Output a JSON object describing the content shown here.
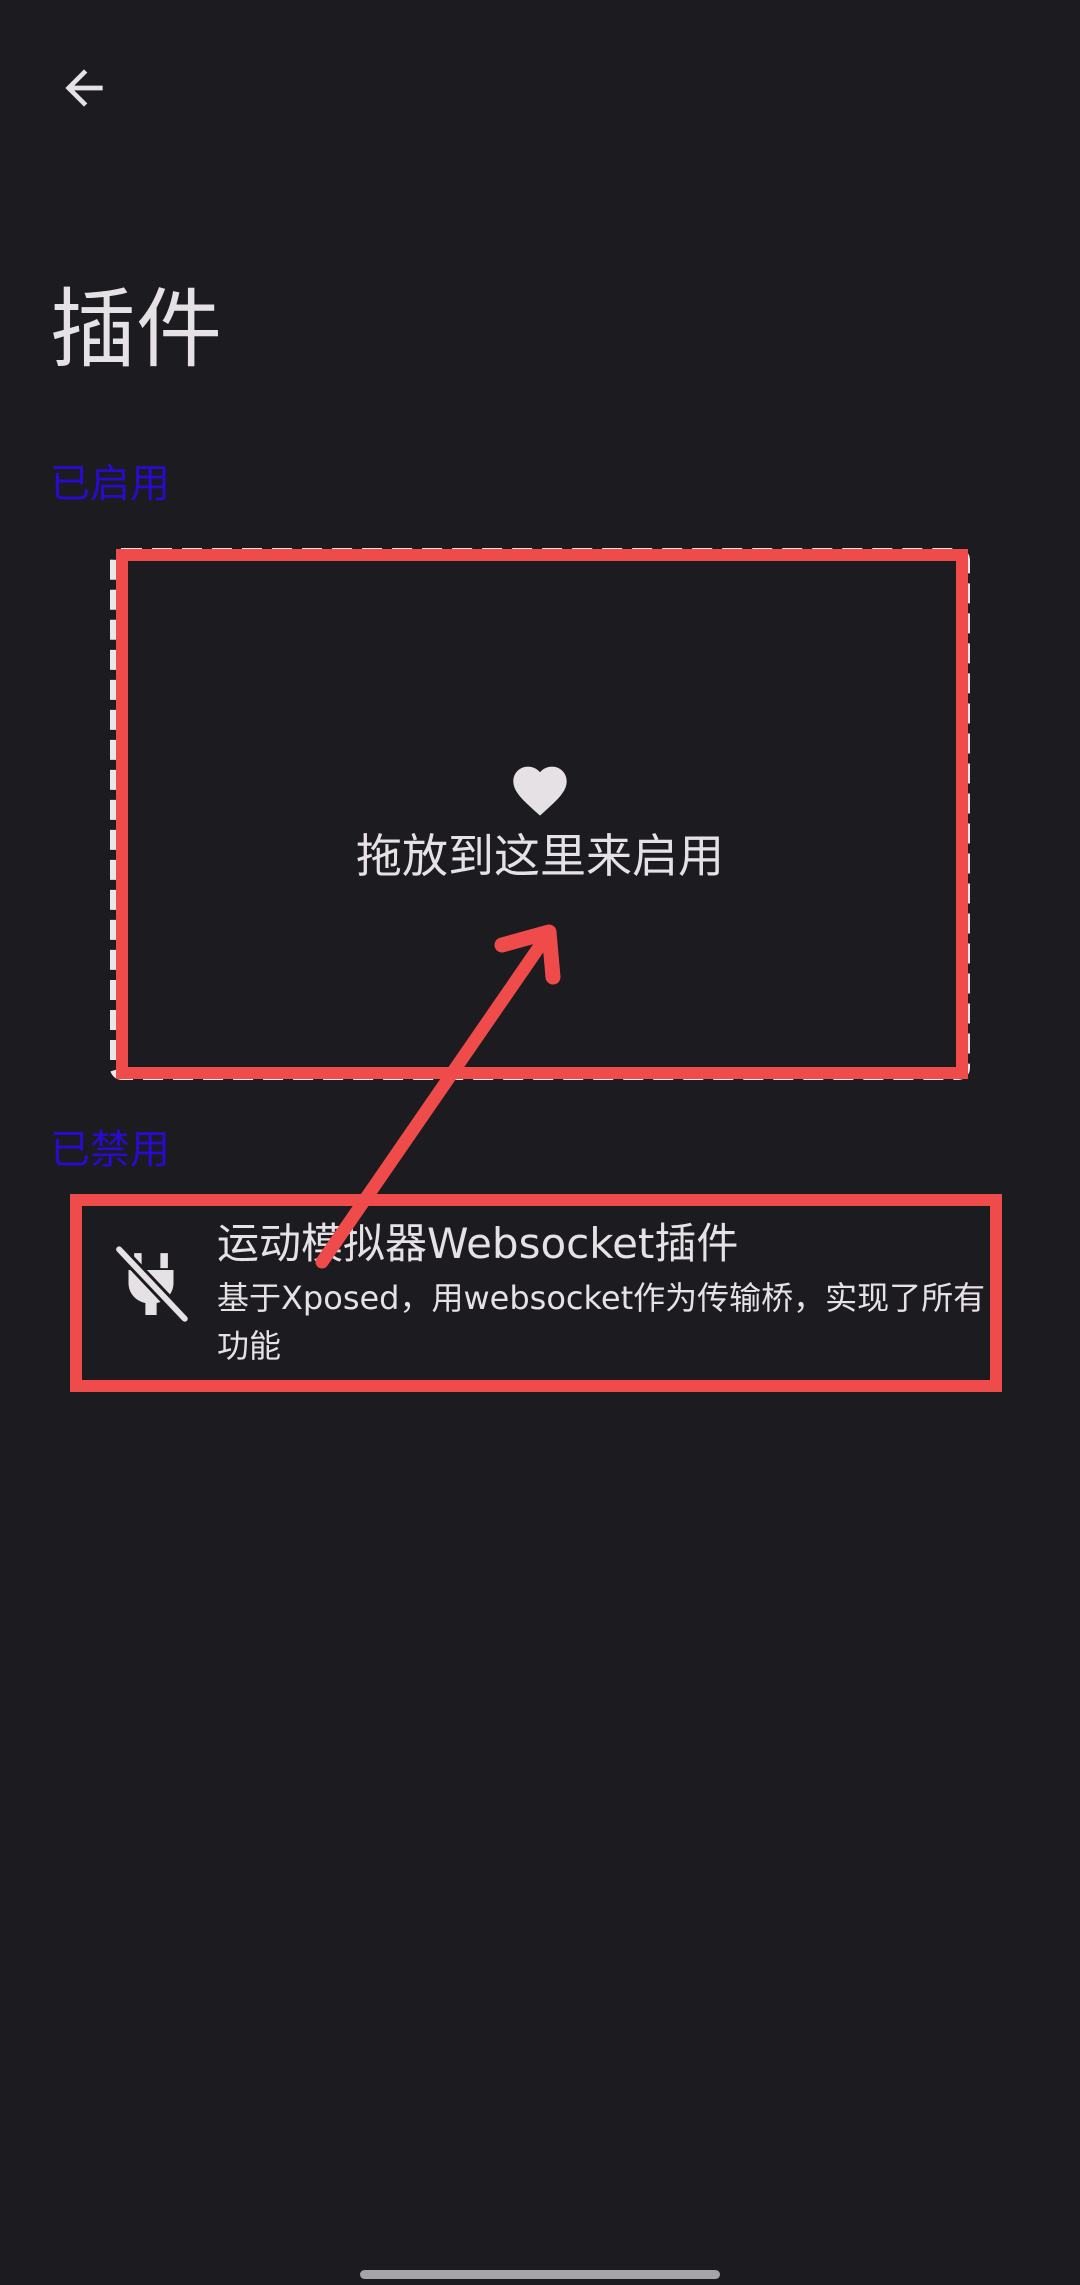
{
  "header": {
    "back_icon": "arrow-back-icon"
  },
  "page": {
    "title": "插件"
  },
  "sections": {
    "enabled_label": "已启用",
    "disabled_label": "已禁用"
  },
  "drop_zone": {
    "icon": "heart-icon",
    "text": "拖放到这里来启用"
  },
  "plugins": [
    {
      "name": "运动模拟器Websocket插件",
      "description": "基于Xposed，用websocket作为传输桥，实现了所有功能",
      "icon": "power-off-icon"
    }
  ],
  "colors": {
    "background": "#1c1b20",
    "section_label": "#2a0acb",
    "annotation": "#ef4b4b",
    "text": "#e6e1e5"
  }
}
